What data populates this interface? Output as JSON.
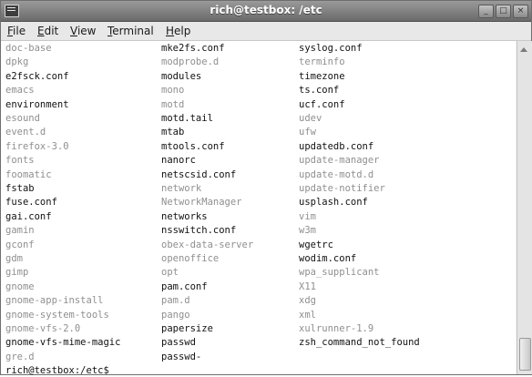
{
  "window": {
    "title": "rich@testbox: /etc",
    "buttons": {
      "minimize": "_",
      "maximize": "□",
      "close": "×"
    }
  },
  "menu": [
    {
      "label": "File",
      "accel": "F",
      "rest": "ile"
    },
    {
      "label": "Edit",
      "accel": "E",
      "rest": "dit"
    },
    {
      "label": "View",
      "accel": "V",
      "rest": "iew"
    },
    {
      "label": "Terminal",
      "accel": "T",
      "rest": "erminal"
    },
    {
      "label": "Help",
      "accel": "H",
      "rest": "elp"
    }
  ],
  "listing": [
    [
      [
        "doc-base",
        "dim"
      ],
      [
        "mke2fs.conf",
        "on"
      ],
      [
        "syslog.conf",
        "on"
      ]
    ],
    [
      [
        "dpkg",
        "dim"
      ],
      [
        "modprobe.d",
        "dim"
      ],
      [
        "terminfo",
        "dim"
      ]
    ],
    [
      [
        "e2fsck.conf",
        "on"
      ],
      [
        "modules",
        "on"
      ],
      [
        "timezone",
        "on"
      ]
    ],
    [
      [
        "emacs",
        "dim"
      ],
      [
        "mono",
        "dim"
      ],
      [
        "ts.conf",
        "on"
      ]
    ],
    [
      [
        "environment",
        "on"
      ],
      [
        "motd",
        "dim"
      ],
      [
        "ucf.conf",
        "on"
      ]
    ],
    [
      [
        "esound",
        "dim"
      ],
      [
        "motd.tail",
        "on"
      ],
      [
        "udev",
        "dim"
      ]
    ],
    [
      [
        "event.d",
        "dim"
      ],
      [
        "mtab",
        "on"
      ],
      [
        "ufw",
        "dim"
      ]
    ],
    [
      [
        "firefox-3.0",
        "dim"
      ],
      [
        "mtools.conf",
        "on"
      ],
      [
        "updatedb.conf",
        "on"
      ]
    ],
    [
      [
        "fonts",
        "dim"
      ],
      [
        "nanorc",
        "on"
      ],
      [
        "update-manager",
        "dim"
      ]
    ],
    [
      [
        "foomatic",
        "dim"
      ],
      [
        "netscsid.conf",
        "on"
      ],
      [
        "update-motd.d",
        "dim"
      ]
    ],
    [
      [
        "fstab",
        "on"
      ],
      [
        "network",
        "dim"
      ],
      [
        "update-notifier",
        "dim"
      ]
    ],
    [
      [
        "fuse.conf",
        "on"
      ],
      [
        "NetworkManager",
        "dim"
      ],
      [
        "usplash.conf",
        "on"
      ]
    ],
    [
      [
        "gai.conf",
        "on"
      ],
      [
        "networks",
        "on"
      ],
      [
        "vim",
        "dim"
      ]
    ],
    [
      [
        "gamin",
        "dim"
      ],
      [
        "nsswitch.conf",
        "on"
      ],
      [
        "w3m",
        "dim"
      ]
    ],
    [
      [
        "gconf",
        "dim"
      ],
      [
        "obex-data-server",
        "dim"
      ],
      [
        "wgetrc",
        "on"
      ]
    ],
    [
      [
        "gdm",
        "dim"
      ],
      [
        "openoffice",
        "dim"
      ],
      [
        "wodim.conf",
        "on"
      ]
    ],
    [
      [
        "gimp",
        "dim"
      ],
      [
        "opt",
        "dim"
      ],
      [
        "wpa_supplicant",
        "dim"
      ]
    ],
    [
      [
        "gnome",
        "dim"
      ],
      [
        "pam.conf",
        "on"
      ],
      [
        "X11",
        "dim"
      ]
    ],
    [
      [
        "gnome-app-install",
        "dim"
      ],
      [
        "pam.d",
        "dim"
      ],
      [
        "xdg",
        "dim"
      ]
    ],
    [
      [
        "gnome-system-tools",
        "dim"
      ],
      [
        "pango",
        "dim"
      ],
      [
        "xml",
        "dim"
      ]
    ],
    [
      [
        "gnome-vfs-2.0",
        "dim"
      ],
      [
        "papersize",
        "on"
      ],
      [
        "xulrunner-1.9",
        "dim"
      ]
    ],
    [
      [
        "gnome-vfs-mime-magic",
        "on"
      ],
      [
        "passwd",
        "on"
      ],
      [
        "zsh_command_not_found",
        "on"
      ]
    ],
    [
      [
        "gre.d",
        "dim"
      ],
      [
        "passwd-",
        "on"
      ],
      [
        "",
        ""
      ]
    ]
  ],
  "prompt": "rich@testbox:/etc$",
  "colors": {
    "text": "#111111",
    "directory": "#8f8f8f",
    "background": "#ffffff",
    "titlebar": "#7a7a7a"
  }
}
